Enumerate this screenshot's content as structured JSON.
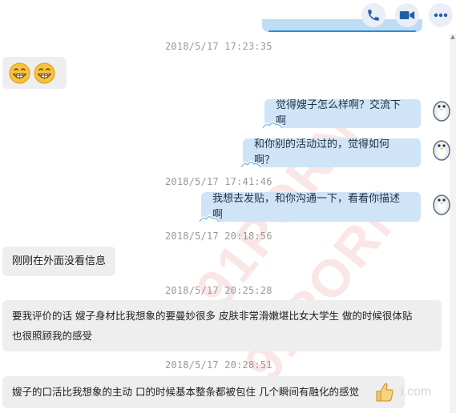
{
  "header": {
    "actions": [
      {
        "name": "phone-call-button",
        "icon": "phone-icon"
      },
      {
        "name": "video-call-button",
        "icon": "video-camera-icon"
      },
      {
        "name": "more-options-button",
        "icon": "more-dots-icon"
      }
    ]
  },
  "colors": {
    "accent": "#2c7fd0",
    "outgoing_bubble": "#cfe5f7",
    "incoming_bubble": "#eeeeee",
    "timestamp": "#999999",
    "watermark": "#dc5050"
  },
  "messages": {
    "ts1": "2018/5/17 17:23:35",
    "incoming_emoji": [
      "grinning-face-emoji",
      "grinning-face-emoji"
    ],
    "out1": "觉得嫂子怎么样啊？交流下啊",
    "out2": "和你别的活动过的，觉得如何啊？",
    "ts2": "2018/5/17 17:41:46",
    "out3": "我想去发贴，和你沟通一下，看看你描述啊",
    "ts3": "2018/5/17 20:18:56",
    "in1": "刚刚在外面没看信息",
    "ts4": "2018/5/17 20:25:28",
    "in2_line1": "要我评价的话 嫂子身材比我想象的要曼妙很多  皮肤非常滑嫩堪比女大学生 做的时候很体贴",
    "in2_line2": "也很照顾我的感受",
    "ts5": "2018/5/17 20:28:51",
    "in3": "嫂子的口活比我想象的主动 口的时候基本整条都被包住 几个瞬间有融化的感觉"
  },
  "watermarks": {
    "text1": "91PORN",
    "text2": "91PORN",
    "site": "i.com"
  }
}
